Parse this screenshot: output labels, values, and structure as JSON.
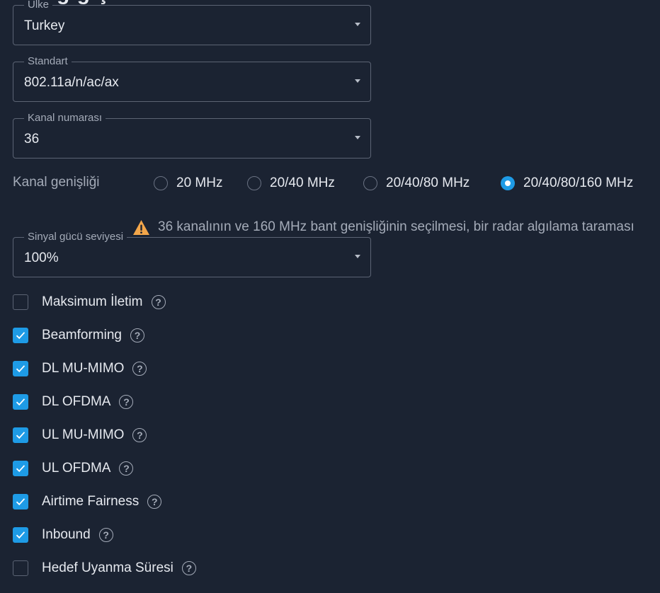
{
  "header": {
    "title_fragment": "g g ş"
  },
  "fields": {
    "country": {
      "label": "Ülke",
      "value": "Turkey"
    },
    "standard": {
      "label": "Standart",
      "value": "802.11a/n/ac/ax"
    },
    "channel": {
      "label": "Kanal numarası",
      "value": "36"
    },
    "power": {
      "label": "Sinyal gücü seviyesi",
      "value": "100%"
    }
  },
  "channel_width": {
    "label": "Kanal genişliği",
    "options": [
      "20 MHz",
      "20/40 MHz",
      "20/40/80 MHz",
      "20/40/80/160 MHz"
    ],
    "selected": "20/40/80/160 MHz"
  },
  "warning": {
    "icon": "warning-icon",
    "text": "36 kanalının ve 160 MHz bant genişliğinin seçilmesi, bir radar algılama taraması",
    "color": "#f3a64a"
  },
  "options": [
    {
      "label": "Maksimum İletim",
      "checked": false
    },
    {
      "label": "Beamforming",
      "checked": true
    },
    {
      "label": "DL MU-MIMO",
      "checked": true
    },
    {
      "label": "DL OFDMA",
      "checked": true
    },
    {
      "label": "UL MU-MIMO",
      "checked": true
    },
    {
      "label": "UL OFDMA",
      "checked": true
    },
    {
      "label": "Airtime Fairness",
      "checked": true
    },
    {
      "label": "Inbound",
      "checked": true
    },
    {
      "label": "Hedef Uyanma Süresi",
      "checked": false
    }
  ],
  "help_glyph": "?",
  "colors": {
    "accent": "#1e9be6",
    "background": "#1b2332",
    "warning": "#f3a64a"
  }
}
